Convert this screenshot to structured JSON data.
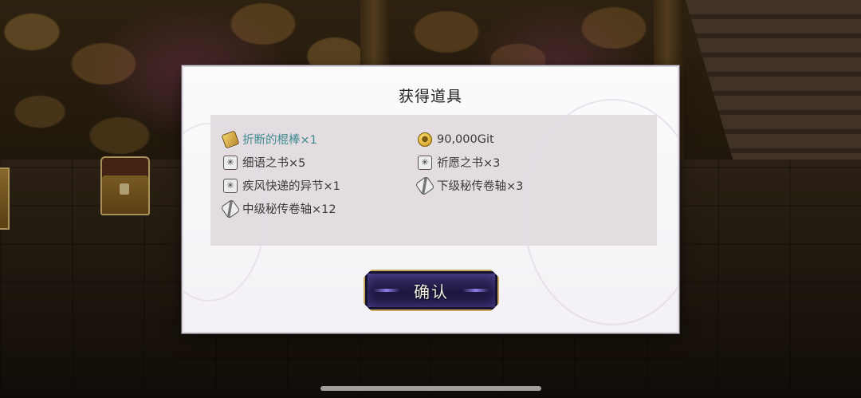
{
  "dialog": {
    "title": "获得道具",
    "confirm_label": "确认"
  },
  "items": [
    {
      "icon": "stick-icon",
      "text": "折断的棍棒×1",
      "highlight": true
    },
    {
      "icon": "coin-icon",
      "text": "90,000Git",
      "highlight": false
    },
    {
      "icon": "book-icon",
      "text": "细语之书×5",
      "highlight": false
    },
    {
      "icon": "book-icon",
      "text": "祈愿之书×3",
      "highlight": false
    },
    {
      "icon": "book-icon",
      "text": "疾风快递的异节×1",
      "highlight": false
    },
    {
      "icon": "scroll-icon",
      "text": "下级秘传卷轴×3",
      "highlight": false
    },
    {
      "icon": "scroll-icon",
      "text": "中级秘传卷轴×12",
      "highlight": false
    }
  ],
  "colors": {
    "highlight_text": "#3f8a8e",
    "button_border": "#c8a95b",
    "button_fill": "#1c1740"
  }
}
